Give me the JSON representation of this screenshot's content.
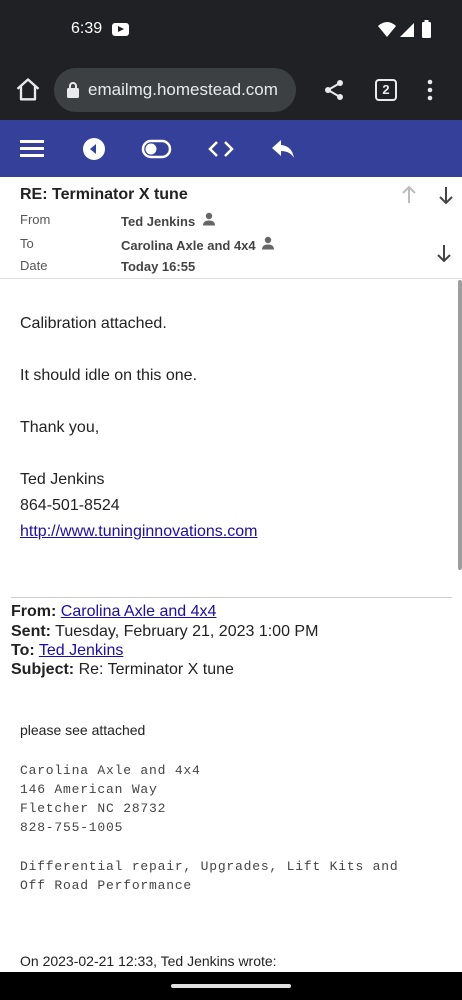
{
  "status": {
    "time": "6:39"
  },
  "browser": {
    "url": "emailmg.homestead.com",
    "tab_count": "2"
  },
  "email": {
    "subject": "RE: Terminator X tune",
    "from_label": "From",
    "from_value": "Ted Jenkins",
    "to_label": "To",
    "to_value": "Carolina Axle and 4x4",
    "date_label": "Date",
    "date_value": "Today 16:55",
    "body": {
      "line1": "Calibration attached.",
      "line2": "It should idle on this one.",
      "line3": "Thank you,",
      "sig_name": "Ted Jenkins",
      "sig_phone": "864-501-8524",
      "sig_link": "http://www.tuninginnovations.com"
    },
    "quoted": {
      "from_label": "From:",
      "from_value": "Carolina Axle and 4x4",
      "sent_label": "Sent:",
      "sent_value": "Tuesday, February 21, 2023 1:00 PM",
      "to_label": "To:",
      "to_value": "Ted Jenkins",
      "subject_label": "Subject:",
      "subject_value": "Re: Terminator X tune",
      "body_line": "please see attached",
      "sig1": "Carolina Axle and 4x4",
      "sig2": "146 American Way",
      "sig3": "Fletcher NC 28732",
      "sig4": "828-755-1005",
      "sig5": "Differential repair, Upgrades, Lift Kits and",
      "sig6": "Off Road Performance",
      "wrote_line": "On 2023-02-21 12:33, Ted Jenkins wrote:"
    }
  },
  "colors": {
    "toolbar": "#35409a",
    "link": "#1a0dab",
    "chrome": "#202124"
  }
}
